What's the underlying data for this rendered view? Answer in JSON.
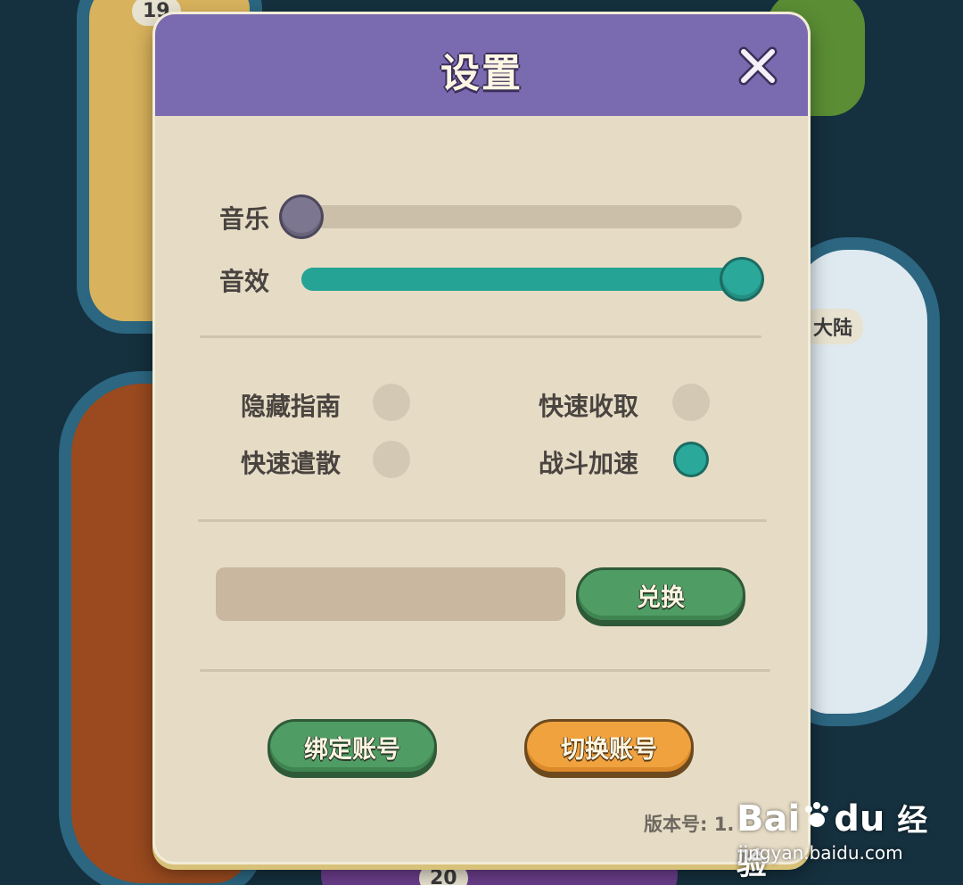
{
  "map": {
    "label_right": "大陆",
    "label_top": "19",
    "label_bottom": "20"
  },
  "dialog": {
    "title": "设置",
    "close_icon": "close-icon"
  },
  "audio": {
    "music_label": "音乐",
    "music_level": 0.0,
    "sfx_label": "音效",
    "sfx_level": 1.0
  },
  "toggles": {
    "hide_guide": {
      "label": "隐藏指南",
      "on": false
    },
    "quick_collect": {
      "label": "快速收取",
      "on": false
    },
    "quick_dispatch": {
      "label": "快速遣散",
      "on": false
    },
    "battle_speed": {
      "label": "战斗加速",
      "on": true
    }
  },
  "redeem": {
    "placeholder": "",
    "button_label": "兑换"
  },
  "account": {
    "bind_label": "绑定账号",
    "switch_label": "切换账号"
  },
  "version": {
    "label": "版本号:",
    "value": "1."
  },
  "watermark": {
    "brand_left": "Bai",
    "brand_right": "du",
    "brand_cn": "经验",
    "url": "jingyan.baidu.com"
  },
  "colors": {
    "header": "#7a6bb0",
    "panel": "#e6dcc6",
    "teal": "#25a395",
    "green_button": "#4f9d64",
    "orange_button": "#f0a23e"
  }
}
